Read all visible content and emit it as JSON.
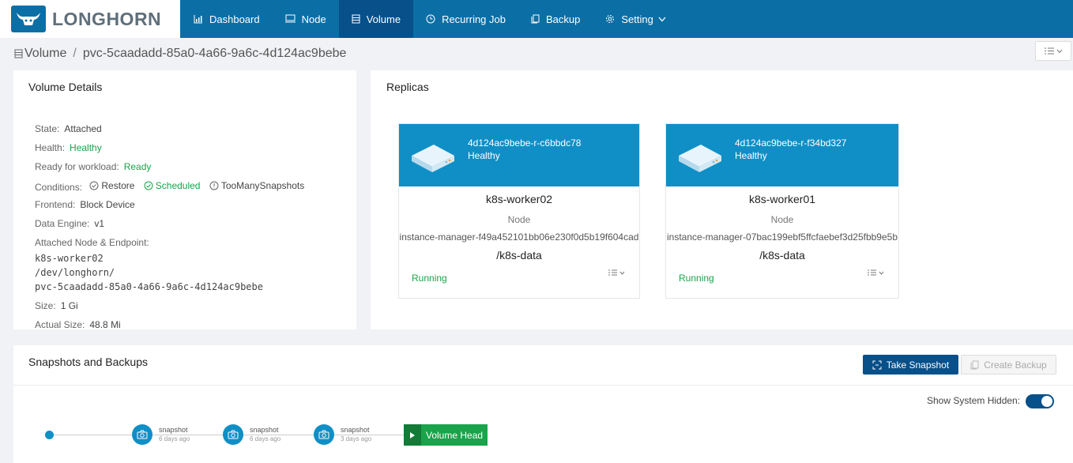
{
  "brand": {
    "name": "LONGHORN"
  },
  "nav": [
    {
      "label": "Dashboard",
      "icon": "dashboard-icon"
    },
    {
      "label": "Node",
      "icon": "monitor-icon"
    },
    {
      "label": "Volume",
      "icon": "volume-icon",
      "active": true
    },
    {
      "label": "Recurring Job",
      "icon": "clock-icon"
    },
    {
      "label": "Backup",
      "icon": "copy-icon"
    },
    {
      "label": "Setting",
      "icon": "gear-icon",
      "dropdown": true
    }
  ],
  "breadcrumb": {
    "root": "Volume",
    "sep": "/",
    "current": "pvc-5caadadd-85a0-4a66-9a6c-4d124ac9bebe"
  },
  "volume_details": {
    "title": "Volume Details",
    "state_label": "State:",
    "state": "Attached",
    "health_label": "Health:",
    "health": "Healthy",
    "ready_label": "Ready for workload:",
    "ready": "Ready",
    "conditions_label": "Conditions:",
    "conditions": [
      "Restore",
      "Scheduled",
      "TooManySnapshots"
    ],
    "frontend_label": "Frontend:",
    "frontend": "Block Device",
    "engine_label": "Data Engine:",
    "engine": "v1",
    "attached_label": "Attached Node & Endpoint:",
    "attached_node": "k8s-worker02",
    "endpoint_1": "/dev/longhorn/",
    "endpoint_2": "pvc-5caadadd-85a0-4a66-9a6c-4d124ac9bebe",
    "size_label": "Size:",
    "size": "1 Gi",
    "actual_label": "Actual Size:",
    "actual": "48.8 Mi"
  },
  "replicas": {
    "title": "Replicas",
    "items": [
      {
        "name": "4d124ac9bebe-r-c6bbdc78",
        "health": "Healthy",
        "node": "k8s-worker02",
        "node_label": "Node",
        "instance_manager": "instance-manager-f49a452101bb06e230f0d5b19f604cad",
        "path": "/k8s-data",
        "status": "Running"
      },
      {
        "name": "4d124ac9bebe-r-f34bd327",
        "health": "Healthy",
        "node": "k8s-worker01",
        "node_label": "Node",
        "instance_manager": "instance-manager-07bac199ebf5ffcfaebef3d25fbb9e5b",
        "path": "/k8s-data",
        "status": "Running"
      }
    ]
  },
  "snapshots": {
    "title": "Snapshots and Backups",
    "take_label": "Take Snapshot",
    "backup_label": "Create Backup",
    "system_hidden_label": "Show System Hidden:",
    "system_hidden_on": true,
    "items": [
      {
        "label": "snapshot",
        "age": "6 days ago"
      },
      {
        "label": "snapshot",
        "age": "6 days ago"
      },
      {
        "label": "snapshot",
        "age": "3 days ago"
      }
    ],
    "head_label": "Volume Head"
  },
  "colors": {
    "nav": "#0b6fa6",
    "nav_active": "#07508a",
    "accent": "#0f8fc6",
    "success": "#1aa34a"
  }
}
